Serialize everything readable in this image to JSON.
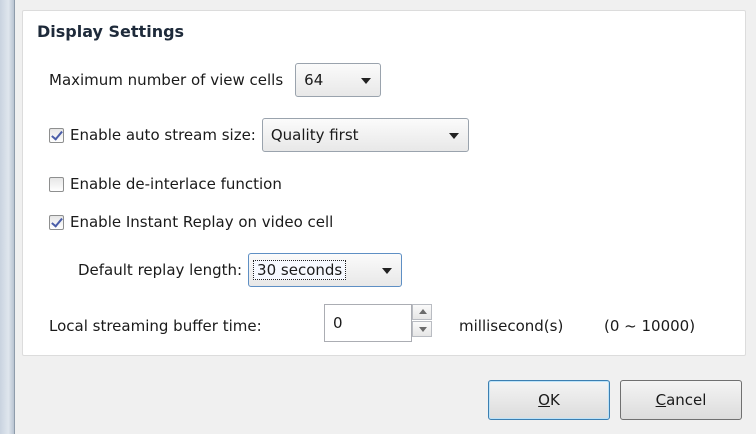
{
  "group": {
    "title": "Display Settings"
  },
  "max_cells": {
    "label": "Maximum number of view cells",
    "value": "64"
  },
  "auto_stream": {
    "label": "Enable auto stream size:",
    "checked": true,
    "value": "Quality first"
  },
  "deinterlace": {
    "label": "Enable de-interlace function",
    "checked": false
  },
  "instant_replay": {
    "label": "Enable Instant Replay on video cell",
    "checked": true
  },
  "replay_length": {
    "label": "Default replay length:",
    "value": "30 seconds"
  },
  "buffer": {
    "label": "Local streaming buffer time:",
    "value": "0",
    "unit": "millisecond(s)",
    "range": "(0 ~ 10000)"
  },
  "buttons": {
    "ok_mnemonic": "O",
    "ok_rest": "K",
    "cancel_mnemonic": "C",
    "cancel_rest": "ancel"
  }
}
